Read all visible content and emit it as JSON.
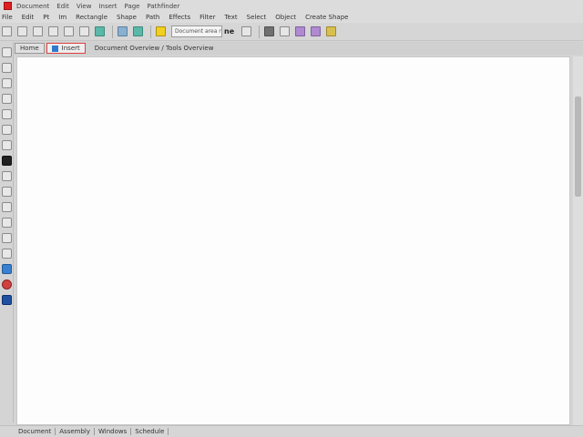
{
  "window": {
    "title_segments": [
      "Document",
      "Edit",
      "View",
      "Insert",
      "Page",
      "Pathfinder"
    ]
  },
  "menu": {
    "items": [
      "File",
      "Edit",
      "Pt",
      "Im",
      "Rectangle",
      "Shape",
      "Path",
      "Effects",
      "Filter",
      "Text",
      "Select",
      "Object",
      "Create Shape"
    ]
  },
  "toolbar": {
    "search_value": "Document area new",
    "search_suffix": "ne"
  },
  "tabs": {
    "items": [
      {
        "label": "Home"
      },
      {
        "label": "Insert"
      }
    ],
    "path": "Document Overview / Tools Overview"
  },
  "status": {
    "items": [
      "Document",
      "Assembly",
      "Windows",
      "Schedule"
    ]
  },
  "colors": {
    "accent_red": "#e02020",
    "tab_blue": "#2f7ad0",
    "canvas_bg": "#fdfdfd"
  }
}
